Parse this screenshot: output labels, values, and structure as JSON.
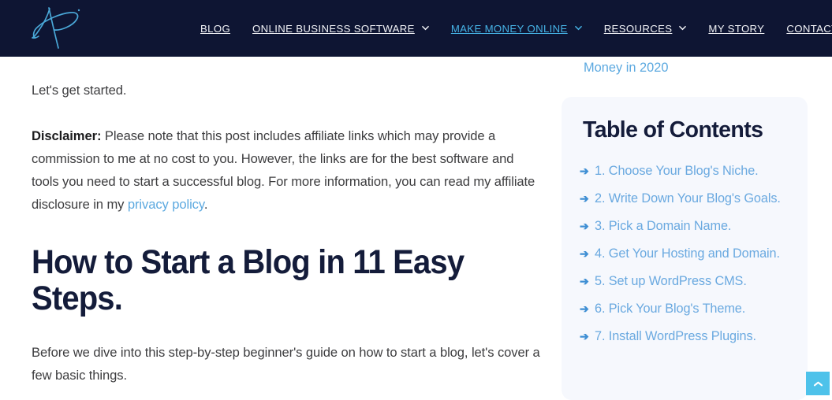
{
  "header": {
    "background_color": "#0e1533",
    "logo": {
      "name": "site-logo-signature",
      "color": "#4aa8d8"
    },
    "nav": [
      {
        "label": "BLOG",
        "has_dropdown": false,
        "active": false
      },
      {
        "label": "ONLINE BUSINESS SOFTWARE",
        "has_dropdown": true,
        "active": false
      },
      {
        "label": "MAKE MONEY ONLINE",
        "has_dropdown": true,
        "active": true
      },
      {
        "label": "RESOURCES",
        "has_dropdown": true,
        "active": false
      },
      {
        "label": "MY STORY",
        "has_dropdown": false,
        "active": false
      },
      {
        "label": "CONTACT",
        "has_dropdown": false,
        "active": false
      }
    ],
    "active_color": "#46b3e6",
    "link_color": "#f2f3f7"
  },
  "article": {
    "paragraph_lets_start": "Let's get started.",
    "disclaimer_label": "Disclaimer:",
    "disclaimer_text_1": " Please note that this post includes affiliate links which may provide a commission to me at no cost to you. However, the links are for the best software and tools you need to start a successful blog. For more information, you can read my affiliate disclosure in my ",
    "disclaimer_link": "privacy policy",
    "disclaimer_text_2": ".",
    "heading": "How to Start a Blog in 11 Easy Steps.",
    "paragraph_before": "Before we dive into this step-by-step beginner's guide on how to start a blog, let's cover a few basic things.",
    "link_color": "#5ca9e0",
    "heading_color": "#141c3a"
  },
  "sidebar": {
    "previous_link_tail": "Money in 2020",
    "toc": {
      "title": "Table of Contents",
      "background_color": "#f6f8fd",
      "arrow_glyph": "➔",
      "items": [
        {
          "label": "1. Choose Your Blog's Niche."
        },
        {
          "label": "2. Write Down Your Blog's Goals."
        },
        {
          "label": "3. Pick a Domain Name."
        },
        {
          "label": "4. Get Your Hosting and Domain."
        },
        {
          "label": "5. Set up WordPress CMS."
        },
        {
          "label": "6. Pick Your Blog's Theme."
        },
        {
          "label": "7. Install WordPress Plugins."
        }
      ]
    }
  },
  "scroll_top_button": {
    "name": "scroll-to-top",
    "color": "#4ec2ea",
    "icon": "chevron-up-icon"
  }
}
